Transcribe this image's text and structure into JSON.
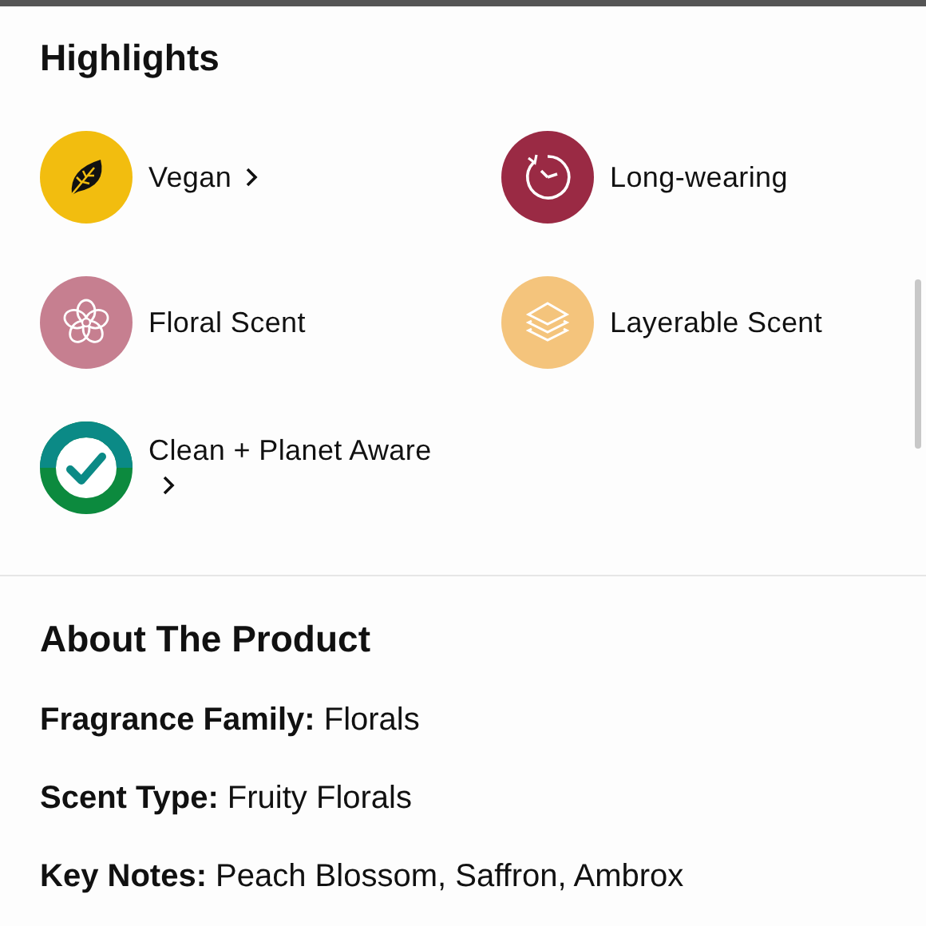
{
  "highlights": {
    "title": "Highlights",
    "items": [
      {
        "kind": "leaf",
        "color": "#f2bd0f",
        "label": "Vegan",
        "link": true
      },
      {
        "kind": "clock",
        "color": "#9a2a44",
        "label": "Long-wearing",
        "link": false
      },
      {
        "kind": "flower",
        "color": "#c67f90",
        "label": "Floral Scent",
        "link": false
      },
      {
        "kind": "layers",
        "color": "#f4c47c",
        "label": "Layerable Scent",
        "link": false
      },
      {
        "kind": "check",
        "color": "#0c8a3e",
        "label": "Clean + Planet Aware",
        "link": true
      }
    ]
  },
  "about": {
    "title": "About The Product",
    "details": [
      "**Fragrance Family:** Florals",
      "**Scent Type:** Fruity Florals",
      "**Key Notes:** Peach Blossom, Saffron, Ambrox"
    ]
  }
}
